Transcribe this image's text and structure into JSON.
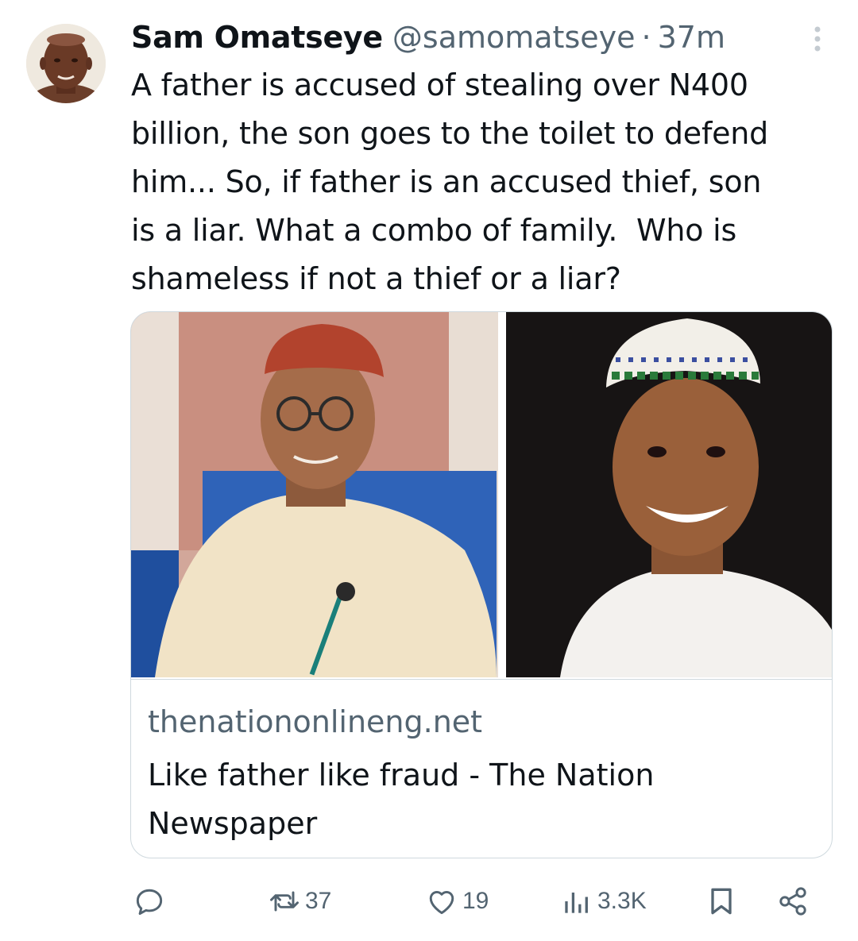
{
  "author": {
    "name": "Sam Omatseye",
    "handle": "@samomatseye",
    "separator": "·",
    "time": "37m"
  },
  "tweet": {
    "text": "A father is accused of stealing over N400\nbillion, the son goes to the toilet to defend\nhim... So, if father is an accused thief, son\nis a liar. What a combo of family.  Who is\nshameless if not a thief or a liar?"
  },
  "card": {
    "domain": "thenationonlineng.net",
    "title": "Like father like fraud - The Nation Newspaper"
  },
  "actions": {
    "reply_icon": "reply-icon",
    "retweet_icon": "retweet-icon",
    "retweets": "37",
    "like_icon": "heart-icon",
    "likes": "19",
    "views_icon": "views-icon",
    "views": "3.3K",
    "bookmark_icon": "bookmark-icon",
    "share_icon": "share-icon"
  },
  "colors": {
    "text": "#0f1419",
    "secondary": "#536471",
    "border": "#cfd9de",
    "background": "#ffffff"
  }
}
